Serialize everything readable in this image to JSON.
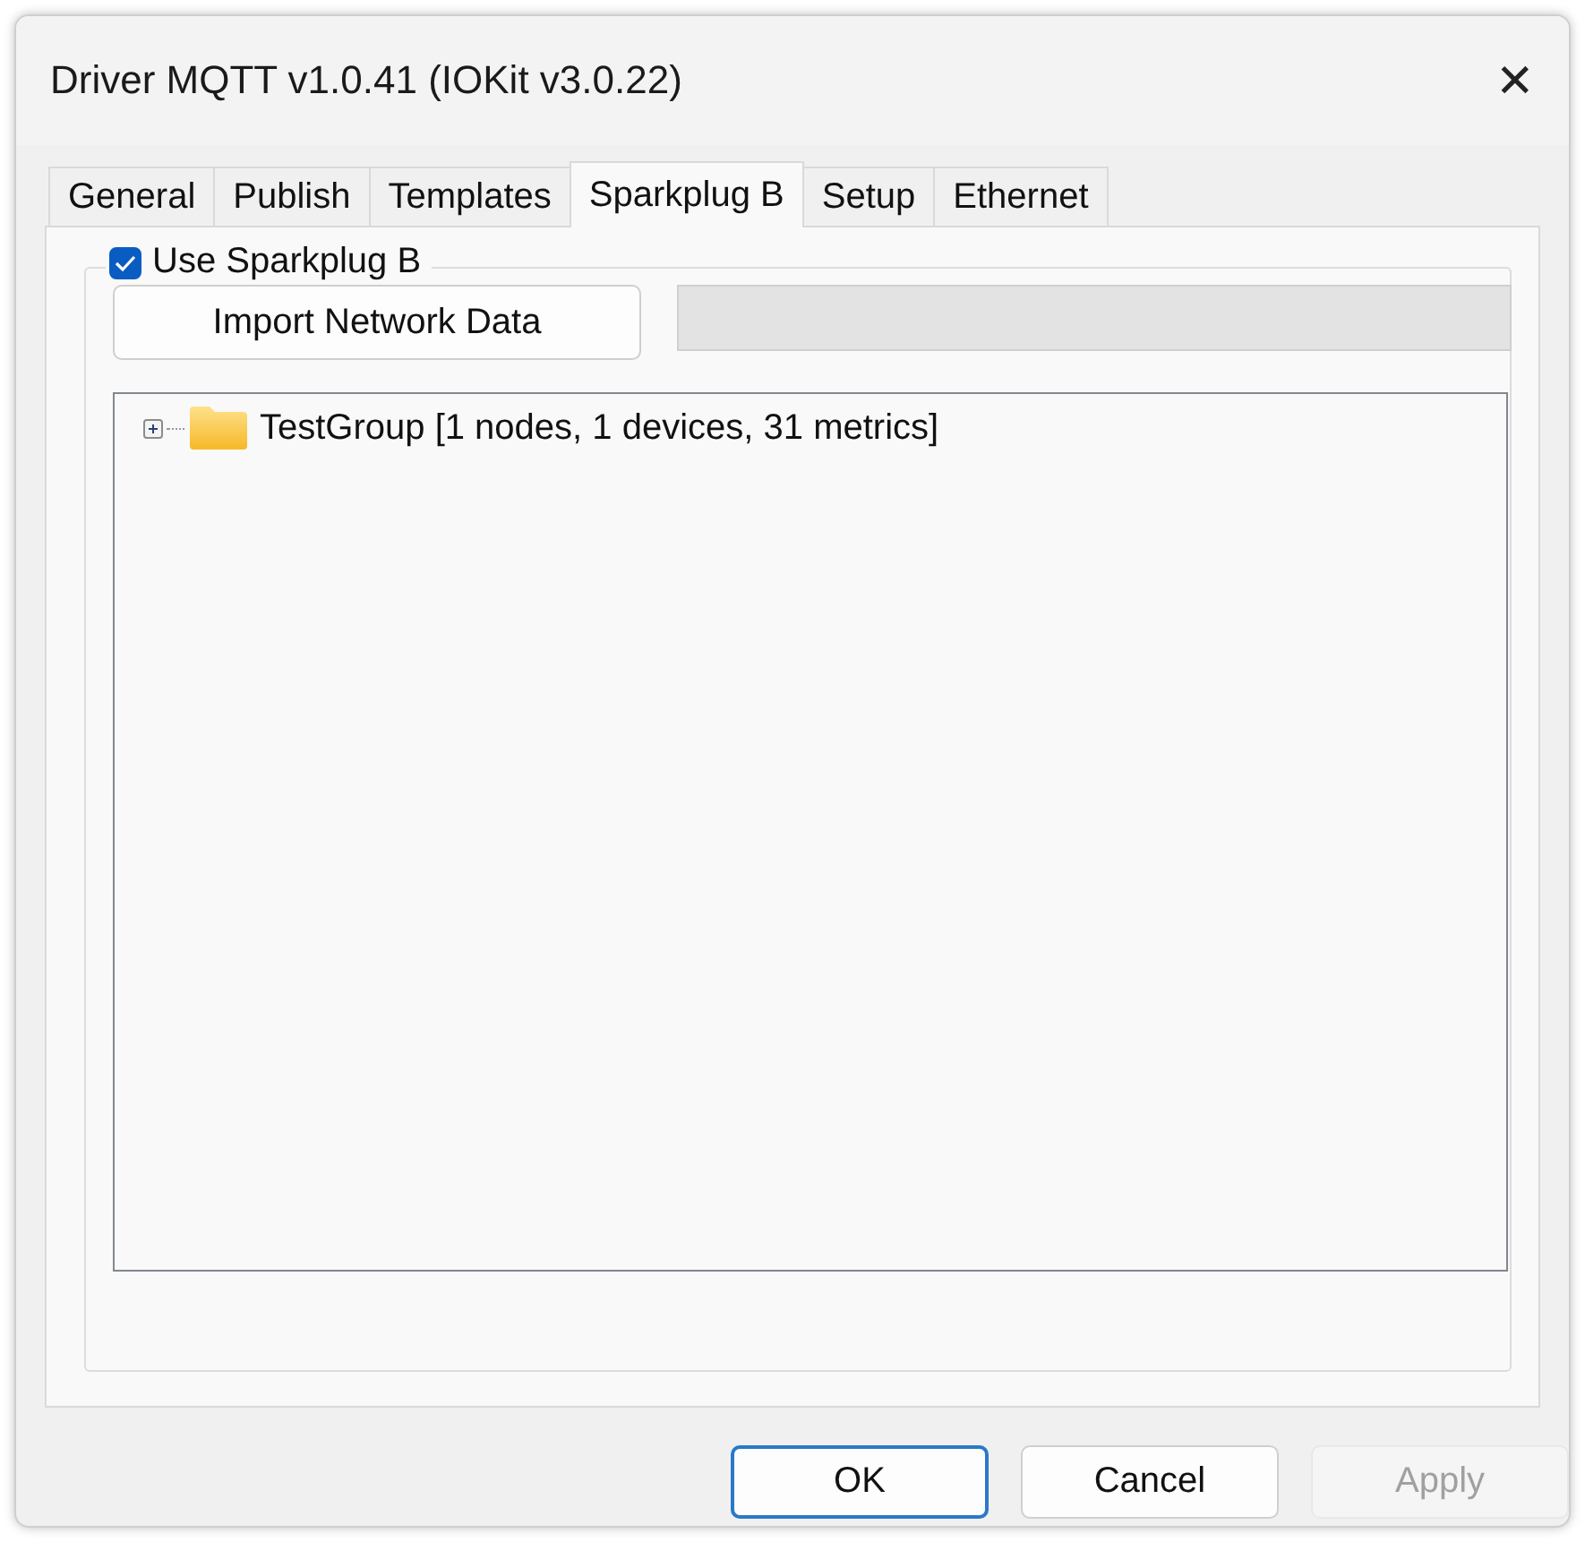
{
  "window": {
    "title": "Driver MQTT v1.0.41 (IOKit v3.0.22)",
    "close": "✕"
  },
  "tabs": [
    {
      "label": "General",
      "selected": false
    },
    {
      "label": "Publish",
      "selected": false
    },
    {
      "label": "Templates",
      "selected": false
    },
    {
      "label": "Sparkplug B",
      "selected": true
    },
    {
      "label": "Setup",
      "selected": false
    },
    {
      "label": "Ethernet",
      "selected": false
    }
  ],
  "group": {
    "label": "Use Sparkplug B",
    "checked": true
  },
  "import_button": "Import Network Data",
  "tree": [
    {
      "label": "TestGroup [1 nodes, 1 devices, 31 metrics]",
      "expanded": false
    }
  ],
  "buttons": [
    {
      "label": "OK",
      "default": true,
      "disabled": false
    },
    {
      "label": "Cancel",
      "default": false,
      "disabled": false
    },
    {
      "label": "Apply",
      "default": false,
      "disabled": true
    }
  ]
}
